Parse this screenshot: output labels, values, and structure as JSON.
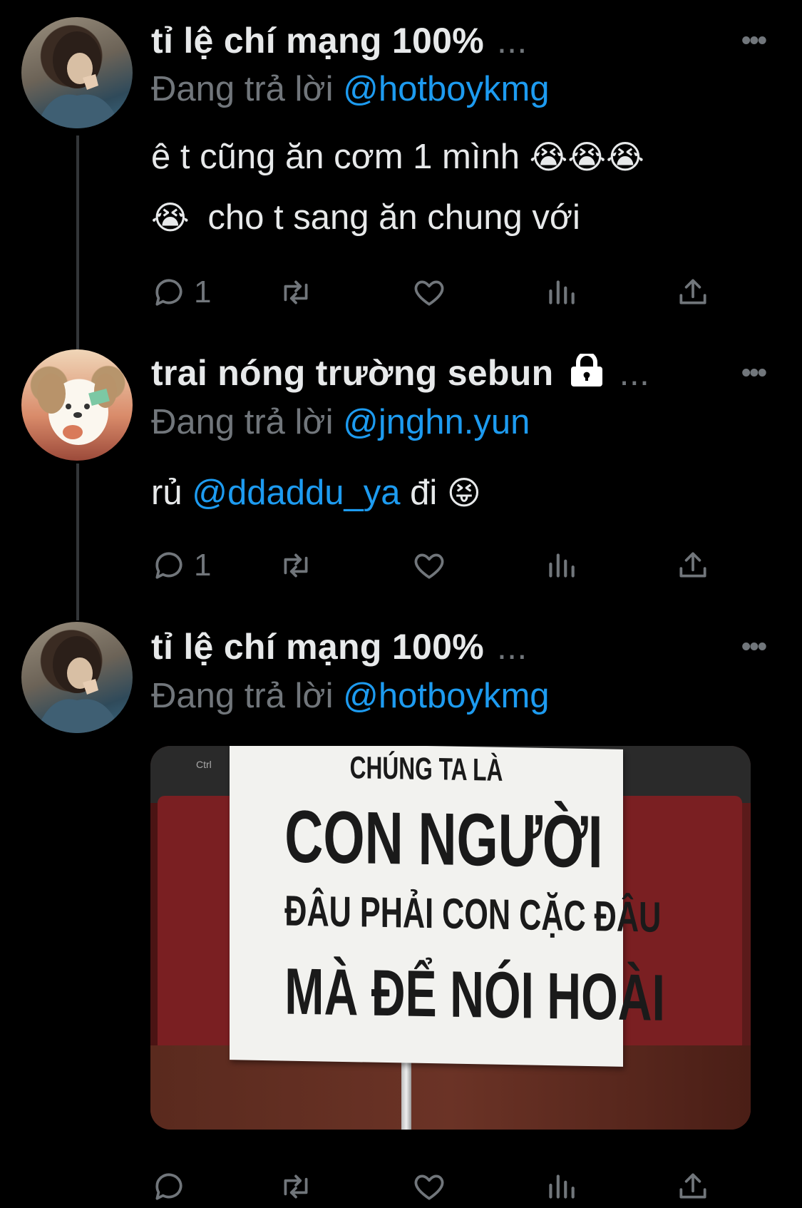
{
  "tweets": [
    {
      "author": "tỉ lệ chí mạng 100%",
      "ellipsis": "...",
      "replying_prefix": "Đang trả lời",
      "replying_handle": "@hotboykmg",
      "text_lines": [
        "ê t cũng ăn cơm 1 mình",
        "cho t sang ăn chung với"
      ],
      "emojis_line1": "😭😭😭",
      "emoji_line2": "😭",
      "reply_count": "1"
    },
    {
      "author": "trai nóng trường sebun",
      "ellipsis": "...",
      "replying_prefix": "Đang trả lời",
      "replying_handle": "@jnghn.yun",
      "text_prefix": "rủ",
      "mention": "@ddaddu_ya",
      "text_suffix": "đi",
      "emoji": "😝",
      "reply_count": "1"
    },
    {
      "author": "tỉ lệ chí mạng 100%",
      "ellipsis": "...",
      "replying_prefix": "Đang trả lời",
      "replying_handle": "@hotboykmg",
      "image_text": {
        "line1": "CHÚNG TA LÀ",
        "line2": "CON NGƯỜI",
        "line3": "ĐÂU PHẢI CON CẶC ĐÂU",
        "line4": "MÀ ĐỂ NÓI HOÀI"
      },
      "keyboard_key": "Ctrl"
    }
  ],
  "more_icon": "more-horizontal-icon",
  "lock_icon": "lock-icon",
  "colors": {
    "background": "#000000",
    "text": "#e7e9ea",
    "muted": "#71767b",
    "accent": "#1d9bf0",
    "thread_line": "#333639"
  }
}
